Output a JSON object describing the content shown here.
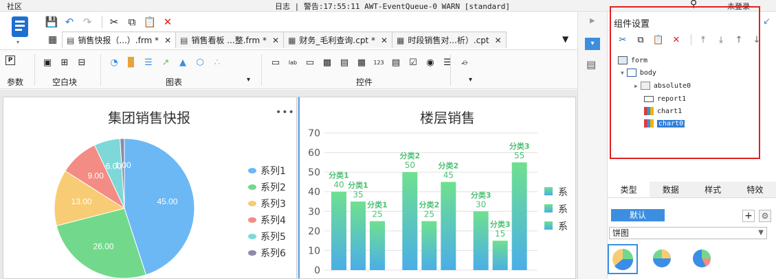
{
  "topbar": {
    "left": "社区",
    "status": "日志 | 警告:17:55:11 AWT-EventQueue-0 WARN [standard]",
    "login": "未登录",
    "search_icon": "search-icon"
  },
  "tabs": [
    {
      "label": "销售快报（...）.frm *",
      "active": true
    },
    {
      "label": "销售看板 ...整.frm *",
      "active": false
    },
    {
      "label": "财务_毛利查询.cpt *",
      "active": false
    },
    {
      "label": "时段销售对...析）.cpt",
      "active": false
    }
  ],
  "ribbon": {
    "groups": [
      "参数",
      "空白块",
      "图表",
      "控件"
    ]
  },
  "chart_left": {
    "title": "集团销售快报",
    "more": "•••"
  },
  "chart_right": {
    "title": "楼层销售"
  },
  "chart_data": [
    {
      "type": "pie",
      "title": "集团销售快报",
      "labels": [
        "系列1",
        "系列2",
        "系列3",
        "系列4",
        "系列5",
        "系列6"
      ],
      "values": [
        45.0,
        26.0,
        13.0,
        9.0,
        6.0,
        1.0
      ],
      "value_labels": [
        "45.00",
        "26.00",
        "13.00",
        "9.00",
        "6.00",
        "1.00"
      ],
      "colors": [
        "#6cb8f4",
        "#72d98c",
        "#f7cc74",
        "#f38c84",
        "#7ed8d8",
        "#8e8aa8"
      ],
      "legend": "right"
    },
    {
      "type": "bar",
      "title": "楼层销售",
      "ylim": [
        0,
        70
      ],
      "yticks": [
        0,
        10,
        20,
        30,
        40,
        50,
        60,
        70
      ],
      "groups": [
        {
          "bars": [
            {
              "label": "分类1",
              "value": 40
            },
            {
              "label": "分类1",
              "value": 35
            },
            {
              "label": "分类1",
              "value": 25
            }
          ]
        },
        {
          "bars": [
            {
              "label": "分类2",
              "value": 50
            },
            {
              "label": "分类2",
              "value": 25
            },
            {
              "label": "分类2",
              "value": 45
            }
          ]
        },
        {
          "bars": [
            {
              "label": "分类3",
              "value": 30
            },
            {
              "label": "分类3",
              "value": 15
            },
            {
              "label": "分类3",
              "value": 55
            }
          ]
        }
      ],
      "legend_items": [
        "系",
        "系",
        "系"
      ],
      "legend": "right"
    }
  ],
  "right_panel": {
    "title": "组件设置",
    "tree": [
      {
        "label": "form",
        "selected": false
      },
      {
        "label": "body",
        "selected": false
      },
      {
        "label": "absolute0",
        "selected": false
      },
      {
        "label": "report1",
        "selected": false
      },
      {
        "label": "chart1",
        "selected": false
      },
      {
        "label": "chart0",
        "selected": true
      }
    ],
    "tabs": [
      "类型",
      "数据",
      "样式",
      "特效"
    ],
    "default_label": "默认",
    "plus": "+",
    "chart_type_value": "饼图"
  }
}
